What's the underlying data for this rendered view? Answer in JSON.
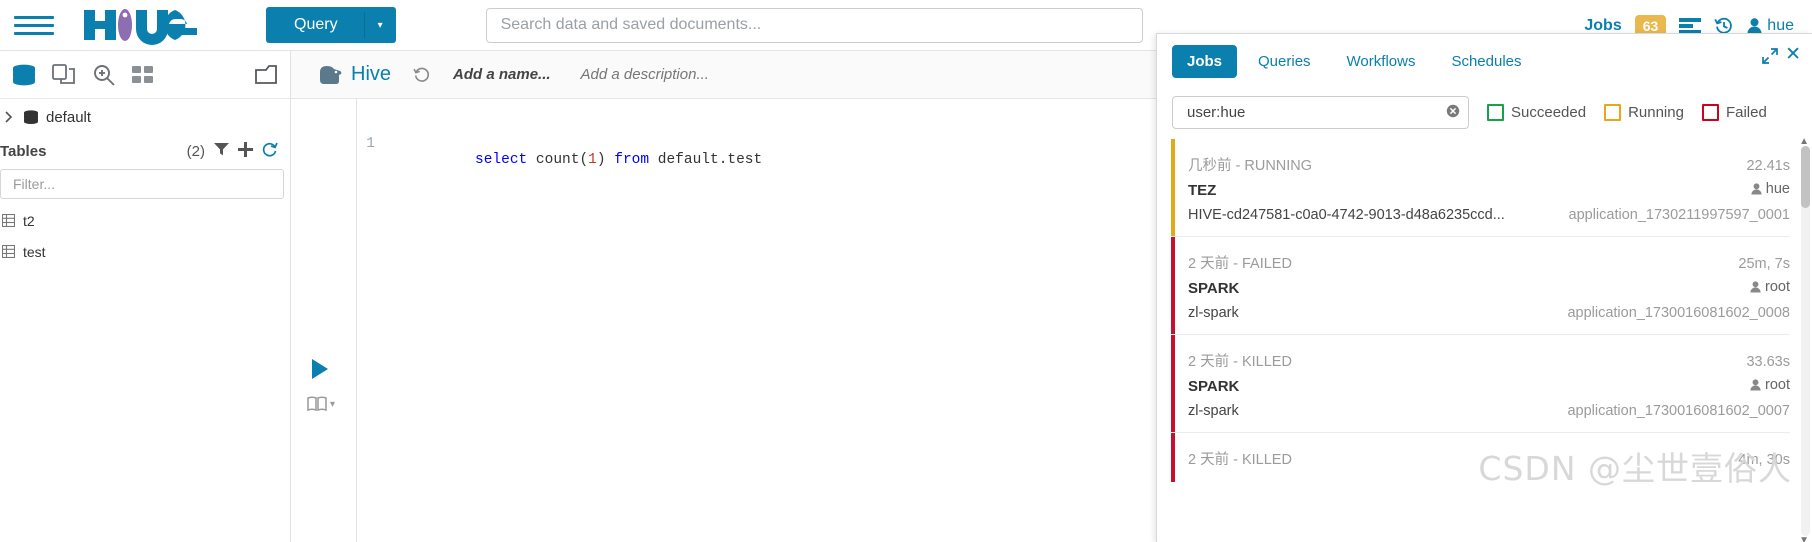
{
  "topbar": {
    "menu_icon": "hamburger-icon",
    "logo_text": "hue",
    "query_button": {
      "label": "Query",
      "caret": "▾"
    },
    "search": {
      "value": "",
      "placeholder": "Search data and saved documents..."
    },
    "jobs_label": "Jobs",
    "jobs_count": "63",
    "assist_icon": "job-browser-icon",
    "history_icon": "history-icon",
    "user": "hue"
  },
  "sidebar": {
    "icons": [
      {
        "name": "database-icon",
        "active": true
      },
      {
        "name": "documents-icon",
        "active": false
      },
      {
        "name": "search-icon",
        "active": false
      },
      {
        "name": "dashboard-icon",
        "active": false
      },
      {
        "name": "collapse-icon",
        "active": false
      }
    ],
    "database": "default",
    "tables_label": "Tables",
    "tables_count": "(2)",
    "filter": {
      "value": "",
      "placeholder": "Filter..."
    },
    "tables": [
      {
        "name": "t2"
      },
      {
        "name": "test"
      }
    ]
  },
  "editor": {
    "engine": "Hive",
    "history_icon": "history-icon",
    "name_placeholder": "Add a name...",
    "description_placeholder": "Add a description...",
    "line_number": "1",
    "code": {
      "kw1": "select",
      "fn": " count(",
      "num": "1",
      "mid": ") ",
      "kw2": "from",
      "tail": " default.test"
    },
    "run_icon": "play-icon",
    "book_icon": "book-icon"
  },
  "jobs_panel": {
    "tabs": [
      {
        "label": "Jobs",
        "active": true
      },
      {
        "label": "Queries",
        "active": false
      },
      {
        "label": "Workflows",
        "active": false
      },
      {
        "label": "Schedules",
        "active": false
      }
    ],
    "expand_icon": "expand-icon",
    "close_icon": "close-icon",
    "search": {
      "value": "user:hue",
      "placeholder": ""
    },
    "clear_icon": "clear-icon",
    "status_filters": [
      {
        "label": "Succeeded",
        "color": "#17a24a",
        "checked": false
      },
      {
        "label": "Running",
        "color": "#E3A919",
        "checked": false
      },
      {
        "label": "Failed",
        "color": "#D0021B",
        "checked": false
      }
    ],
    "jobs": [
      {
        "time": "几秒前 - RUNNING",
        "duration": "22.41s",
        "type": "TEZ",
        "user": "hue",
        "name": "HIVE-cd247581-c0a0-4742-9013-d48a6235ccd...",
        "app_id": "application_1730211997597_0001",
        "accent": "#E3A919"
      },
      {
        "time": "2 天前 - FAILED",
        "duration": "25m, 7s",
        "type": "SPARK",
        "user": "root",
        "name": "zl-spark",
        "app_id": "application_1730016081602_0008",
        "accent": "#C8102E"
      },
      {
        "time": "2 天前 - KILLED",
        "duration": "33.63s",
        "type": "SPARK",
        "user": "root",
        "name": "zl-spark",
        "app_id": "application_1730016081602_0007",
        "accent": "#C8102E"
      },
      {
        "time": "2 天前 - KILLED",
        "duration": "4m, 30s",
        "type": "",
        "user": "",
        "name": "",
        "app_id": "",
        "accent": "#C8102E"
      }
    ]
  },
  "watermark": "CSDN @尘世壹俗人",
  "colors": {
    "brand": "#0B7FAD",
    "badge": "#EBB84D",
    "running": "#E3A919",
    "failed": "#C8102E",
    "succeeded": "#17a24a"
  }
}
